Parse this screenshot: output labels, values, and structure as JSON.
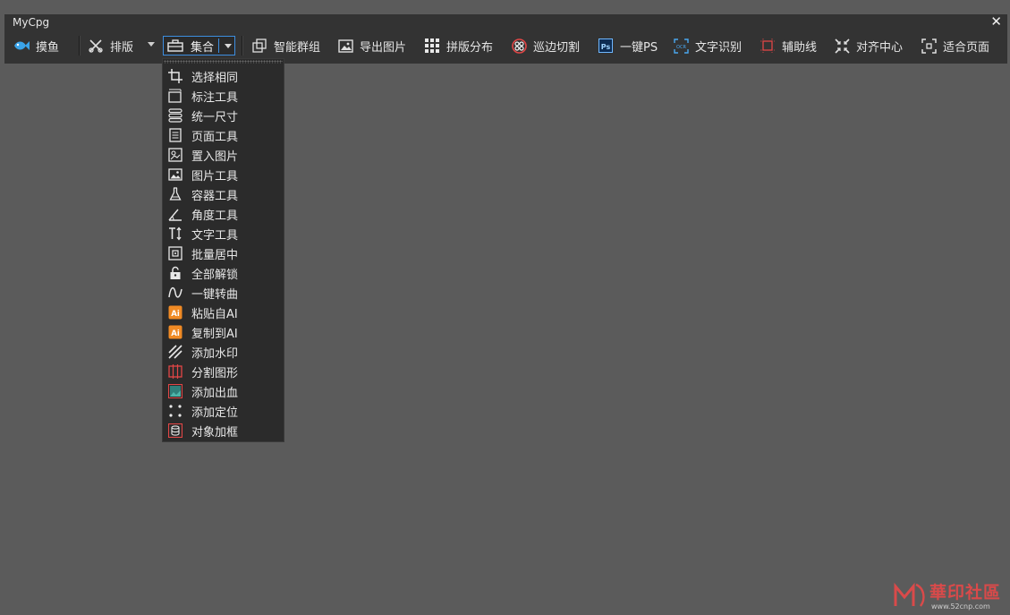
{
  "window": {
    "title": "MyCpg",
    "close_label": "✕"
  },
  "toolbar": {
    "items": [
      {
        "label": "摸鱼",
        "icon": "fish-icon"
      },
      {
        "label": "排版",
        "icon": "scissors-icon"
      },
      {
        "label": "集合",
        "icon": "toolbox-icon"
      },
      {
        "label": "智能群组",
        "icon": "group-icon"
      },
      {
        "label": "导出图片",
        "icon": "image-icon"
      },
      {
        "label": "拼版分布",
        "icon": "grid-icon"
      },
      {
        "label": "巡边切割",
        "icon": "cut-icon"
      },
      {
        "label": "一键PS",
        "icon": "photoshop-icon"
      },
      {
        "label": "文字识别",
        "icon": "ocr-icon"
      },
      {
        "label": "辅助线",
        "icon": "guideline-icon"
      },
      {
        "label": "对齐中心",
        "icon": "align-center-icon"
      },
      {
        "label": "适合页面",
        "icon": "fit-page-icon"
      }
    ]
  },
  "menu": {
    "items": [
      {
        "label": "选择相同",
        "icon": "select-same-icon"
      },
      {
        "label": "标注工具",
        "icon": "dimension-icon"
      },
      {
        "label": "统一尺寸",
        "icon": "uniform-size-icon"
      },
      {
        "label": "页面工具",
        "icon": "page-icon"
      },
      {
        "label": "置入图片",
        "icon": "place-image-icon"
      },
      {
        "label": "图片工具",
        "icon": "picture-icon"
      },
      {
        "label": "容器工具",
        "icon": "flask-icon"
      },
      {
        "label": "角度工具",
        "icon": "angle-icon"
      },
      {
        "label": "文字工具",
        "icon": "text-tool-icon"
      },
      {
        "label": "批量居中",
        "icon": "batch-center-icon"
      },
      {
        "label": "全部解锁",
        "icon": "unlock-icon"
      },
      {
        "label": "一键转曲",
        "icon": "curve-icon"
      },
      {
        "label": "粘贴自AI",
        "icon": "ai-paste-icon"
      },
      {
        "label": "复制到AI",
        "icon": "ai-copy-icon"
      },
      {
        "label": "添加水印",
        "icon": "watermark-icon"
      },
      {
        "label": "分割图形",
        "icon": "split-shape-icon"
      },
      {
        "label": "添加出血",
        "icon": "bleed-icon"
      },
      {
        "label": "添加定位",
        "icon": "position-marks-icon"
      },
      {
        "label": "对象加框",
        "icon": "frame-object-icon"
      }
    ]
  },
  "watermark": {
    "text": "華印社區",
    "url": "www.52cnp.com"
  },
  "colors": {
    "accent": "#3d8ee0",
    "panel": "#333333",
    "background": "#5b5b5b",
    "menu": "#2b2b2b"
  }
}
